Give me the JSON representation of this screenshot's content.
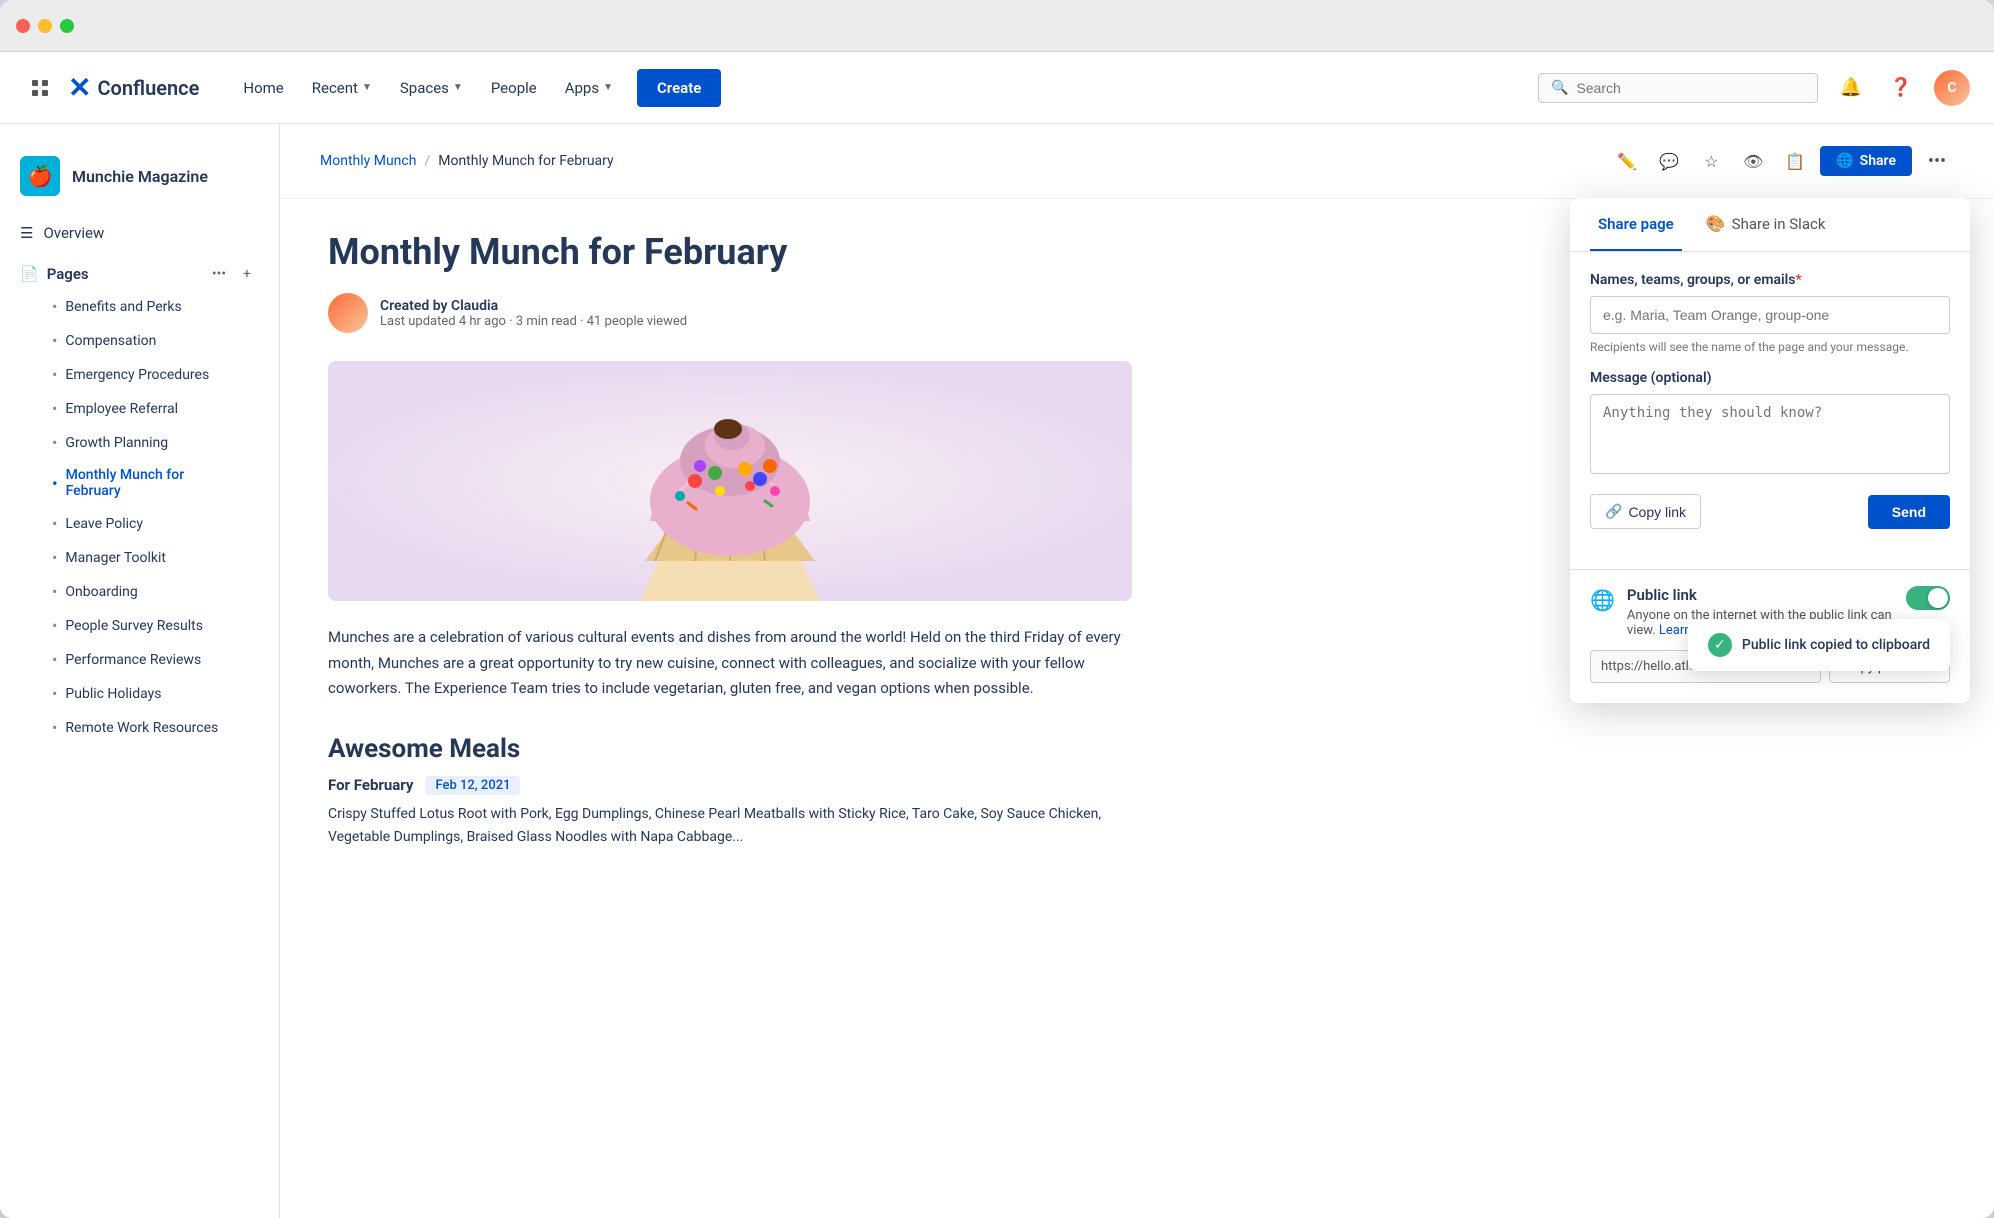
{
  "window": {
    "title": "Confluence"
  },
  "titlebar": {
    "traffic_lights": [
      "red",
      "yellow",
      "green"
    ]
  },
  "topnav": {
    "logo_text": "Confluence",
    "items": [
      {
        "label": "Home",
        "has_dropdown": false
      },
      {
        "label": "Recent",
        "has_dropdown": true
      },
      {
        "label": "Spaces",
        "has_dropdown": true
      },
      {
        "label": "People",
        "has_dropdown": false
      },
      {
        "label": "Apps",
        "has_dropdown": true
      }
    ],
    "create_label": "Create",
    "search_placeholder": "Search",
    "avatar_initials": "C"
  },
  "sidebar": {
    "space_name": "Munchie Magazine",
    "space_icon": "🍎",
    "overview_label": "Overview",
    "pages_label": "Pages",
    "items": [
      {
        "label": "Benefits and Perks",
        "active": false
      },
      {
        "label": "Compensation",
        "active": false
      },
      {
        "label": "Emergency Procedures",
        "active": false
      },
      {
        "label": "Employee Referral",
        "active": false
      },
      {
        "label": "Growth Planning",
        "active": false
      },
      {
        "label": "Monthly Munch for February",
        "active": true
      },
      {
        "label": "Leave Policy",
        "active": false
      },
      {
        "label": "Manager Toolkit",
        "active": false
      },
      {
        "label": "Onboarding",
        "active": false
      },
      {
        "label": "People Survey Results",
        "active": false
      },
      {
        "label": "Performance Reviews",
        "active": false
      },
      {
        "label": "Public Holidays",
        "active": false
      },
      {
        "label": "Remote Work Resources",
        "active": false
      }
    ]
  },
  "breadcrumb": {
    "parent": "Monthly Munch",
    "current": "Monthly Munch for February",
    "separator": "/"
  },
  "toolbar_actions": {
    "edit_icon": "✏️",
    "comment_icon": "💬",
    "star_icon": "☆",
    "view_icon": "👁",
    "share_label": "Share",
    "more_icon": "•••"
  },
  "article": {
    "title": "Monthly Munch for February",
    "author": "Claudia",
    "meta": "Last updated 4 hr ago · 3 min read · 41 people viewed",
    "body": "Munches are a celebration of various cultural events and dishes from around the world! Held on the third Friday of every month, Munches are a great opportunity to try new cuisine, connect with colleagues, and socialize with your fellow coworkers. The Experience Team tries to include vegetarian, gluten free, and vegan options when possible.",
    "section_title": "Awesome Meals",
    "for_label": "For February",
    "date": "Feb 12, 2021",
    "meal_list": "Crispy Stuffed Lotus Root with Pork, Egg Dumplings, Chinese Pearl Meatballs with Sticky Rice, Taro Cake, Soy Sauce Chicken, Vegetable Dumplings, Braised Glass Noodles with Napa Cabbage..."
  },
  "share_panel": {
    "tabs": [
      {
        "label": "Share page",
        "active": true
      },
      {
        "label": "Share in Slack",
        "icon": "🎨",
        "active": false
      }
    ],
    "recipients_label": "Names, teams, groups, or emails",
    "recipients_placeholder": "e.g. Maria, Team Orange, group-one",
    "recipients_hint": "Recipients will see the name of the page and your message.",
    "message_label": "Message (optional)",
    "message_placeholder": "Anything they should know?",
    "copy_link_label": "Copy link",
    "send_label": "Send",
    "public_link_title": "Public link",
    "public_link_desc": "Anyone on the internet with the public link can view.",
    "learn_more_label": "Learn more",
    "public_link_url": "https://hello.atlassian.net/67",
    "copy_public_label": "Copy public link",
    "toggle_enabled": true
  },
  "toast": {
    "message": "Public link copied to clipboard",
    "icon": "✓"
  }
}
